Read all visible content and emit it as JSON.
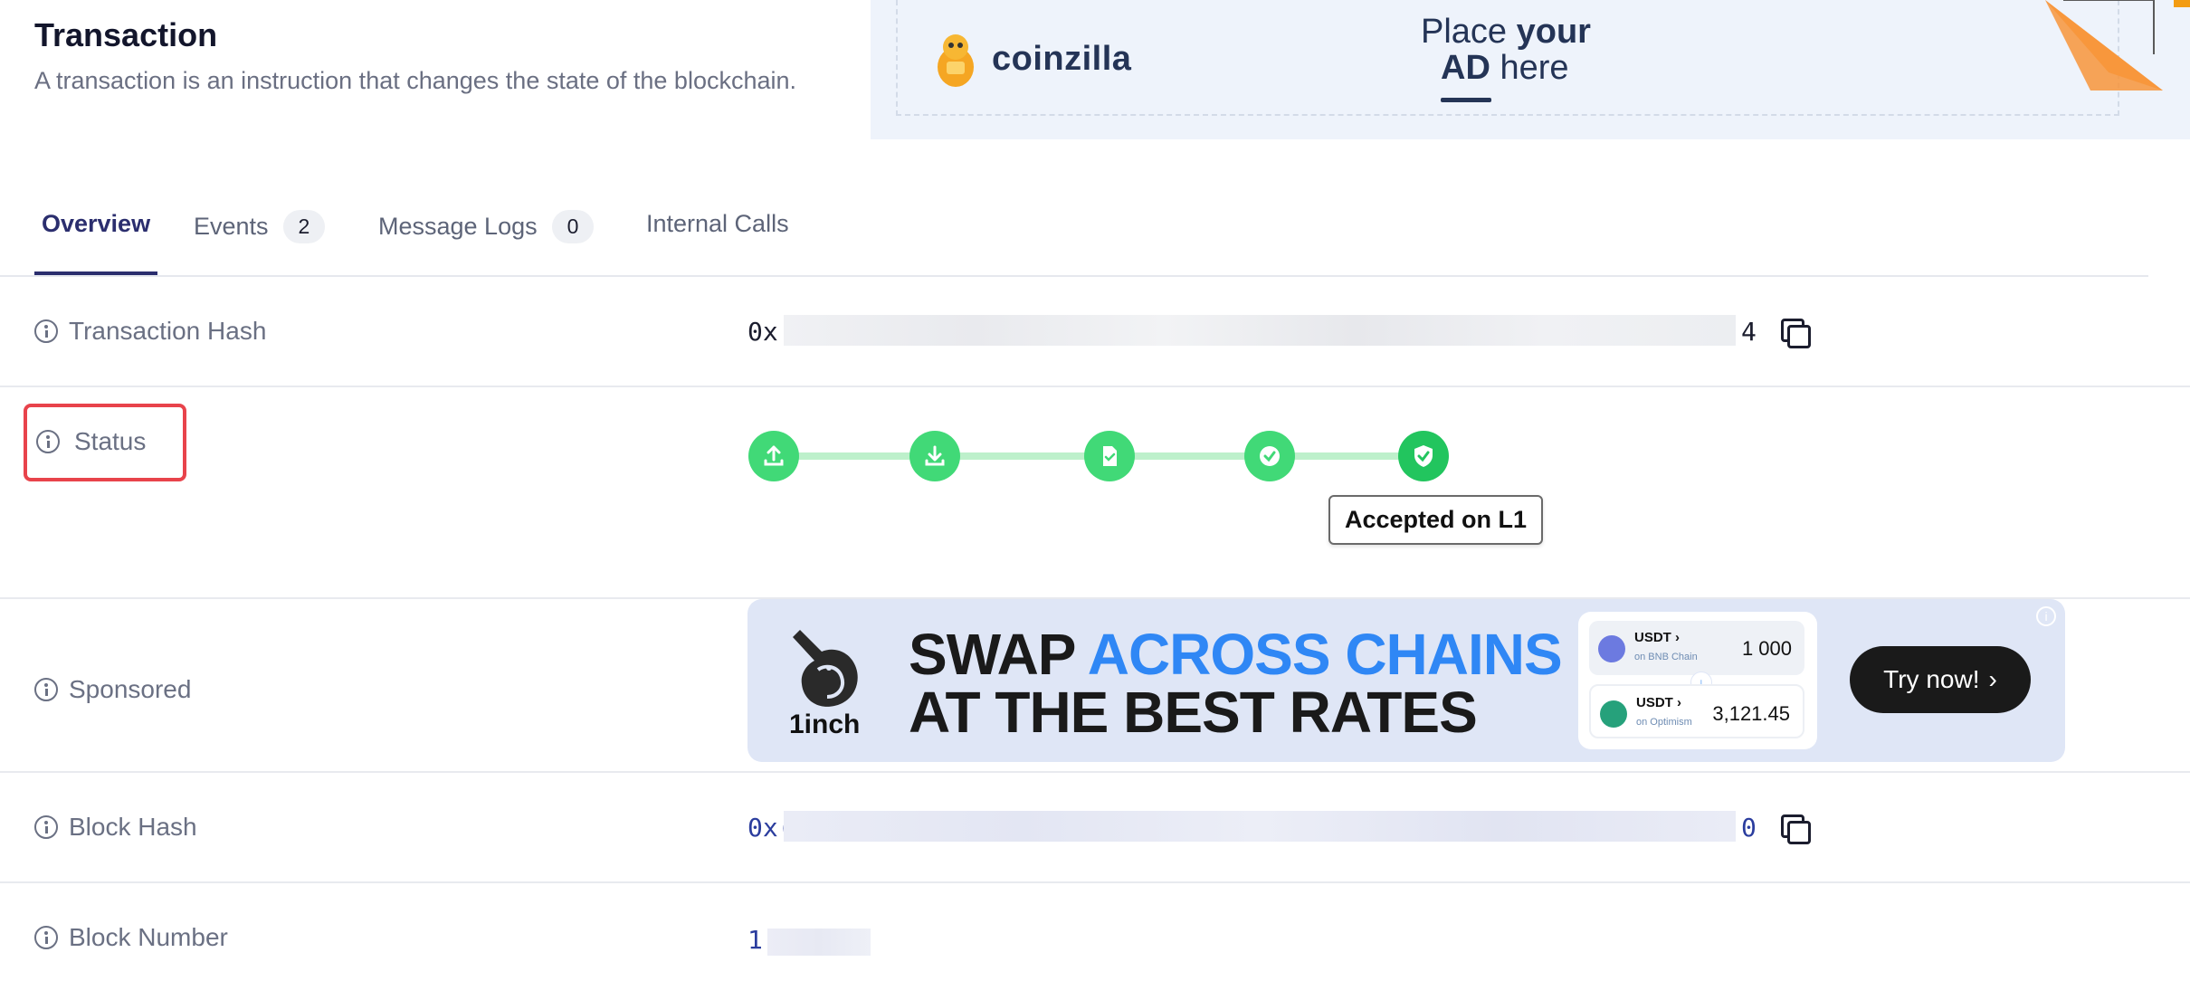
{
  "header": {
    "title": "Transaction",
    "subtitle": "A transaction is an instruction that changes the state of the blockchain."
  },
  "ad_top": {
    "brand": "coinzilla",
    "line1_prefix": "Place ",
    "line1_bold": "your",
    "line2_bold": "AD",
    "line2_suffix": " here"
  },
  "tabs": [
    {
      "label": "Overview"
    },
    {
      "label": "Events",
      "badge": "2"
    },
    {
      "label": "Message Logs",
      "badge": "0"
    },
    {
      "label": "Internal Calls"
    }
  ],
  "rows": {
    "tx_hash": {
      "label": "Transaction Hash",
      "prefix": "0x",
      "suffix": "4"
    },
    "status": {
      "label": "Status",
      "tooltip": "Accepted on L1"
    },
    "sponsored": {
      "label": "Sponsored"
    },
    "block_hash": {
      "label": "Block Hash",
      "prefix": "0x(",
      "suffix": "0"
    },
    "block_number": {
      "label": "Block Number",
      "prefix": "1"
    }
  },
  "ad_1inch": {
    "brand": "1inch",
    "line1_dark": "SWAP ",
    "line1_blue": "ACROSS CHAINS",
    "line2": "AT THE BEST RATES",
    "from_token": "USDT",
    "from_net": "on BNB Chain",
    "from_amount": "1 000",
    "to_token": "USDT",
    "to_net": "on Optimism",
    "to_amount": "3,121.45",
    "cta": "Try now!"
  },
  "colors": {
    "accent": "#2b2e6e",
    "status_green": "#41d977",
    "status_line": "#bdf0cb",
    "highlight_box": "#e8434b",
    "ad_blue": "#2f87f5"
  }
}
